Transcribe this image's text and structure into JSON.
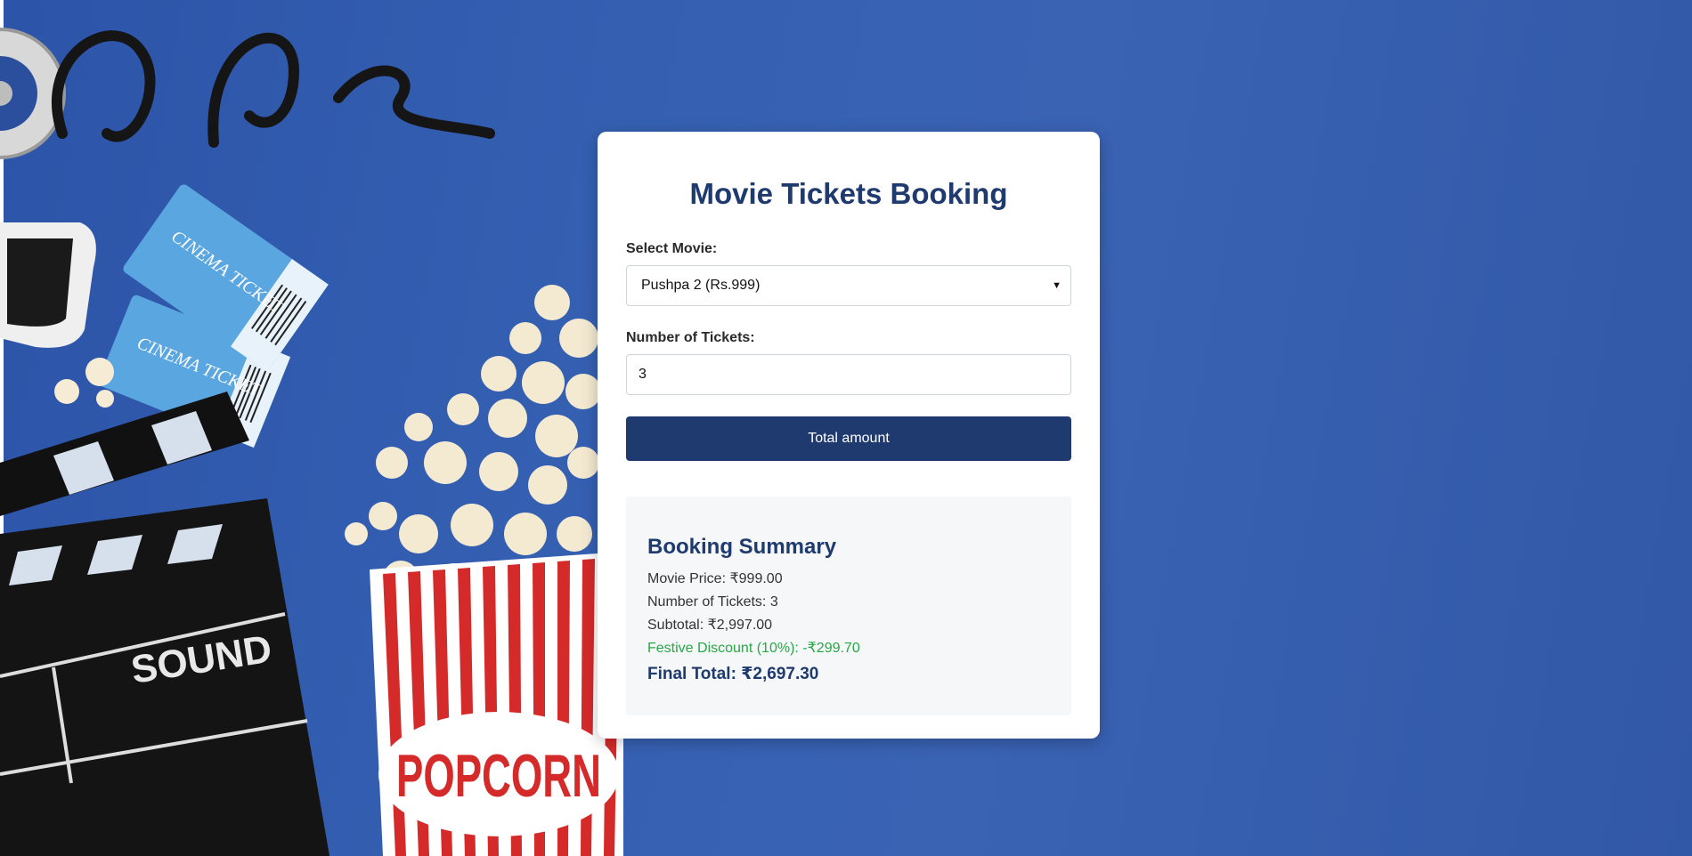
{
  "page": {
    "title": "Movie Tickets Booking"
  },
  "form": {
    "movie_label": "Select Movie:",
    "movie_selected": "Pushpa 2 (Rs.999)",
    "tickets_label": "Number of Tickets:",
    "tickets_value": "3",
    "submit_label": "Total amount"
  },
  "summary": {
    "title": "Booking Summary",
    "movie_price": "Movie Price: ₹999.00",
    "tickets": "Number of Tickets: 3",
    "subtotal": "Subtotal: ₹2,997.00",
    "discount": "Festive Discount (10%): -₹299.70",
    "final_total": "Final Total: ₹2,697.30"
  },
  "background": {
    "ticket_text": "CINEMA TICKET",
    "clapper_text": "SOUND",
    "popcorn_text": "POPCORN"
  },
  "colors": {
    "accent": "#1e3a6e",
    "background": "#3560b2",
    "discount": "#28a745"
  }
}
